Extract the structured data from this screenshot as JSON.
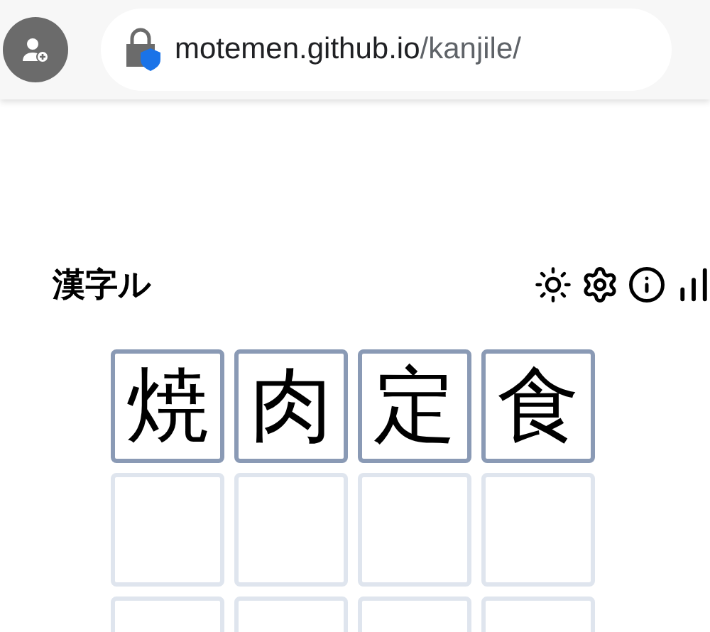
{
  "browser": {
    "url_host": "motemen.github.io",
    "url_path": "/kanjile/"
  },
  "header": {
    "title": "漢字ル"
  },
  "board": {
    "rows": [
      {
        "kind": "guess",
        "letters": [
          "焼",
          "肉",
          "定",
          "食"
        ]
      },
      {
        "kind": "empty"
      },
      {
        "kind": "empty"
      }
    ]
  }
}
